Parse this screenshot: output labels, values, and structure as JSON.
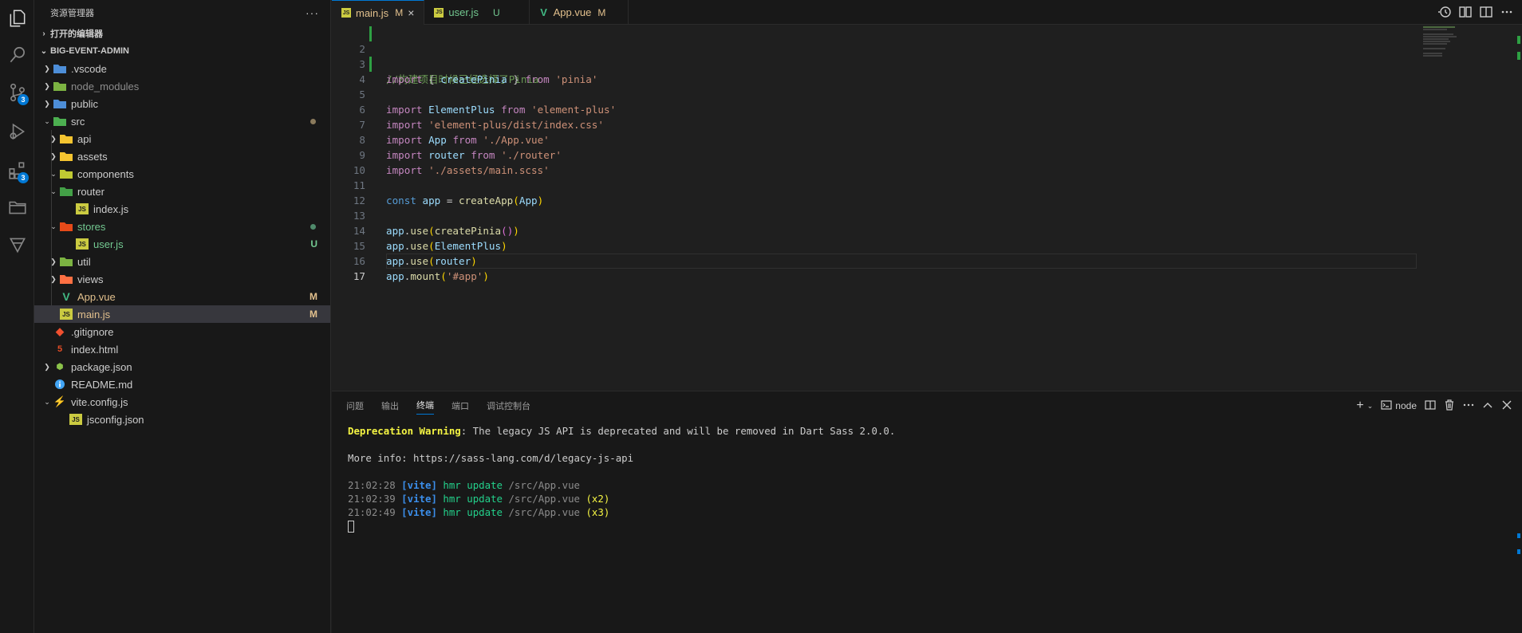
{
  "sidebar": {
    "title": "资源管理器",
    "more": "···",
    "open_editors": "打开的编辑器",
    "project": "BIG-EVENT-ADMIN",
    "items": [
      {
        "label": ".vscode"
      },
      {
        "label": "node_modules"
      },
      {
        "label": "public"
      },
      {
        "label": "src"
      },
      {
        "label": "api"
      },
      {
        "label": "assets"
      },
      {
        "label": "components"
      },
      {
        "label": "router"
      },
      {
        "label": "index.js"
      },
      {
        "label": "stores"
      },
      {
        "label": "user.js",
        "status": "U"
      },
      {
        "label": "util"
      },
      {
        "label": "views"
      },
      {
        "label": "App.vue",
        "status": "M"
      },
      {
        "label": "main.js",
        "status": "M"
      },
      {
        "label": ".gitignore"
      },
      {
        "label": "index.html"
      },
      {
        "label": "package.json"
      },
      {
        "label": "README.md"
      },
      {
        "label": "vite.config.js"
      },
      {
        "label": "jsconfig.json"
      }
    ]
  },
  "activity": {
    "scm_badge": "3",
    "extensions_badge": "3"
  },
  "tabs": [
    {
      "label": "main.js",
      "mod": "M"
    },
    {
      "label": "user.js",
      "mod": "U"
    },
    {
      "label": "App.vue",
      "mod": "M"
    }
  ],
  "editor": {
    "line_numbers": [
      "2",
      "3",
      "4",
      "5",
      "6",
      "7",
      "8",
      "9",
      "10",
      "11",
      "12",
      "13",
      "14",
      "15",
      "16",
      "17"
    ],
    "comment_text": "//构建项目时候已经选择了Pinia",
    "lines": {
      "l3": [
        "import",
        " { ",
        "createPinia",
        " } ",
        "from",
        " 'pinia'"
      ],
      "l5": [
        "import",
        " ",
        "ElementPlus",
        " ",
        "from",
        " 'element-plus'"
      ],
      "l6": [
        "import",
        " 'element-plus/dist/index.css'"
      ],
      "l7": [
        "import",
        " ",
        "App",
        " ",
        "from",
        " './App.vue'"
      ],
      "l8": [
        "import",
        " ",
        "router",
        " ",
        "from",
        " './router'"
      ],
      "l9": [
        "import",
        " './assets/main.scss'"
      ],
      "l11": [
        "const",
        " ",
        "app",
        " = ",
        "createApp",
        "(",
        "App",
        ")"
      ],
      "l13": [
        "app",
        ".",
        "use",
        "(",
        "createPinia",
        "(",
        ")",
        ")"
      ],
      "l14": [
        "app",
        ".",
        "use",
        "(",
        "ElementPlus",
        ")"
      ],
      "l15": [
        "app",
        ".",
        "use",
        "(",
        "router",
        ")"
      ],
      "l16": [
        "app",
        ".",
        "mount",
        "(",
        "'#app'",
        ")"
      ]
    }
  },
  "panel": {
    "tabs": [
      "问题",
      "输出",
      "终端",
      "端口",
      "调试控制台"
    ],
    "active_tab": "终端",
    "shell": "node",
    "terminal": {
      "warn_label": "Deprecation Warning",
      "warn_text": ": The legacy JS API is deprecated and will be removed in Dart Sass 2.0.0.",
      "more_info": "More info: https://sass-lang.com/d/legacy-js-api",
      "hmr": [
        {
          "time": "21:02:28",
          "tag": "[vite]",
          "msg": "hmr update",
          "path": "/src/App.vue",
          "count": ""
        },
        {
          "time": "21:02:39",
          "tag": "[vite]",
          "msg": "hmr update",
          "path": "/src/App.vue",
          "count": "(x2)"
        },
        {
          "time": "21:02:49",
          "tag": "[vite]",
          "msg": "hmr update",
          "path": "/src/App.vue",
          "count": "(x3)"
        }
      ]
    }
  },
  "colors": {
    "accent": "#0078d4",
    "modified": "#e2c08d",
    "untracked": "#73c991",
    "js_icon": "#cbcb41",
    "vue_icon": "#41b883"
  }
}
